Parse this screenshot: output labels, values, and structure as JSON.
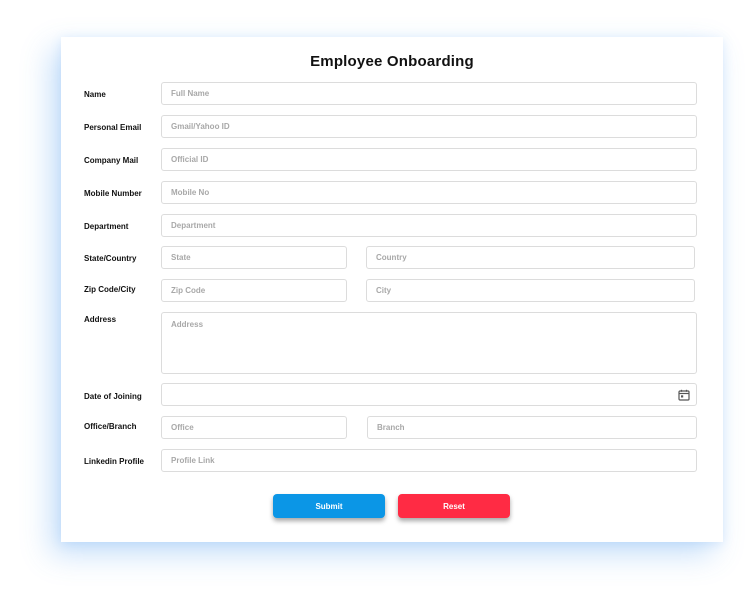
{
  "form": {
    "title": "Employee Onboarding",
    "fields": {
      "name": {
        "label": "Name",
        "placeholder": "Full Name"
      },
      "personal_email": {
        "label": "Personal Email",
        "placeholder": "Gmail/Yahoo ID"
      },
      "company_mail": {
        "label": "Company Mail",
        "placeholder": "Official ID"
      },
      "mobile": {
        "label": "Mobile Number",
        "placeholder": "Mobile No"
      },
      "department": {
        "label": "Department",
        "placeholder": "Department"
      },
      "state_country": {
        "label": "State/Country",
        "placeholder_state": "State",
        "placeholder_country": "Country"
      },
      "zip_city": {
        "label": "Zip Code/City",
        "placeholder_zip": "Zip Code",
        "placeholder_city": "City"
      },
      "address": {
        "label": "Address",
        "placeholder": "Address"
      },
      "date_of_joining": {
        "label": "Date of Joining",
        "icon": "calendar-icon"
      },
      "office_branch": {
        "label": "Office/Branch",
        "placeholder_office": "Office",
        "placeholder_branch": "Branch"
      },
      "linkedin": {
        "label": "Linkedin Profile",
        "placeholder": "Profile Link"
      }
    },
    "buttons": {
      "submit": "Submit",
      "reset": "Reset"
    },
    "colors": {
      "submit": "#0b96e6",
      "reset": "#ff2b44"
    }
  }
}
